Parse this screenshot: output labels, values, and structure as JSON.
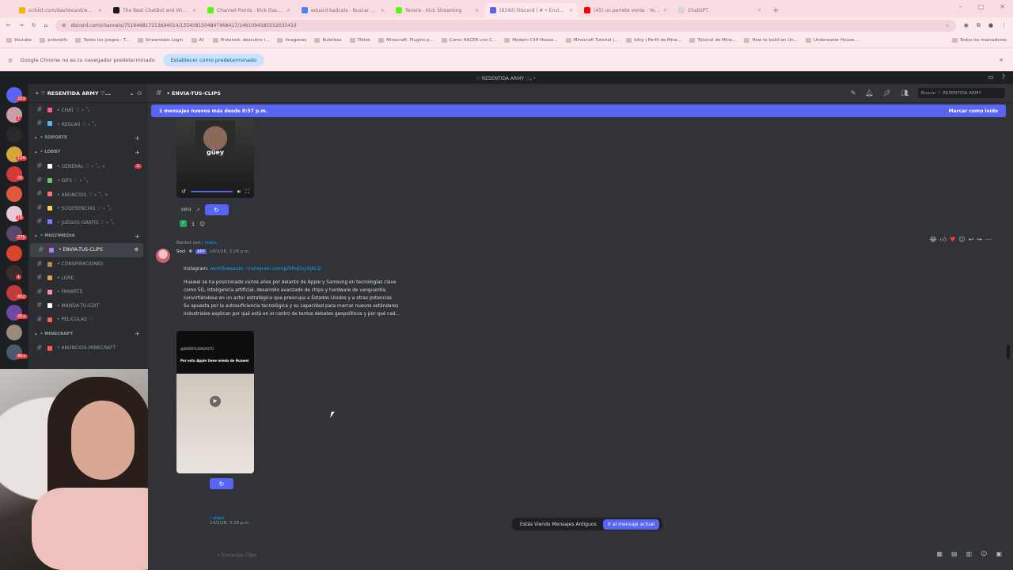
{
  "browser": {
    "tabs": [
      {
        "label": "scikkit.com/dashboard/w...",
        "color": "#f5b400"
      },
      {
        "label": "The Best ChatBot and Widget...",
        "color": "#1a1a1a"
      },
      {
        "label": "Channel Points - Kick Dashb...",
        "color": "#53fc18"
      },
      {
        "label": "eduard badcats - Buscar con G...",
        "color": "#4285f4"
      },
      {
        "label": "Tenera - Kick Streaming",
        "color": "#53fc18"
      },
      {
        "label": "(8340) Discord | # • Envía...",
        "color": "#5865f2"
      },
      {
        "label": "(45) un perrete verde - YouTube",
        "color": "#ff0000"
      },
      {
        "label": "ChatGPT",
        "color": "#d5d5d5"
      }
    ],
    "url": "discord.com/channels/751946817213694014/1354581504847468417/1461094585552035410",
    "bookmarks": [
      "Youtube",
      "anienstfv",
      "Todos los juegos - T...",
      "Streamlabs Login",
      "AI:",
      "Pinterest: descubre i...",
      "Imagenes",
      "Ruletitas",
      "Tiktok",
      "Minecraft: Plugins p...",
      "Como HACER uno C...",
      "Modern Cliff House...",
      "Minecraft Tutorial |...",
      "kitty | Perfil de Mine...",
      "Tutorial de Mine...",
      "How to build an Un...",
      "Underwater House...",
      "Todos los marcadores"
    ],
    "info_text": "Google Chrome no es tu navegador predeterminado",
    "info_button": "Establecer como predeterminado"
  },
  "discord": {
    "window_title": "♡ RESENTIDA ARMY ♡。・",
    "server_name": "✧ ♡ RESENTIDA ARMY ♡...",
    "server_badges": [
      "203",
      "1",
      "124",
      "30",
      "16",
      "275",
      "1",
      "402",
      "2K+",
      "4K+"
    ],
    "channels": [
      {
        "kind": "ch",
        "label": "• CHAT ♡ ⋆ ˚｡",
        "color": "#ff5c8a"
      },
      {
        "kind": "ch",
        "label": "• REGLAS ♡ ⋆ ˚｡",
        "color": "#5ab3ff"
      },
      {
        "kind": "cat",
        "label": "• SOPORTE"
      },
      {
        "kind": "cat",
        "label": "• LOBBY"
      },
      {
        "kind": "ch",
        "label": "• GENERAL ♡ ⋆ ˚｡ ✧",
        "color": "#ffffff",
        "unread": "1"
      },
      {
        "kind": "ch",
        "label": "• GIFS ♡ ⋆ ˚｡",
        "color": "#6ac46a"
      },
      {
        "kind": "ch",
        "label": "• ANUNCIOS ♡ ⋆ ˚｡ ✧",
        "color": "#ff7070"
      },
      {
        "kind": "ch",
        "label": "• SUGERENCIAS ♡ ⋆ ˚｡",
        "color": "#ffd34d"
      },
      {
        "kind": "ch",
        "label": "• JUEGOS-GRATIS ♡ ⋆ ˚｡",
        "color": "#7a7aff"
      },
      {
        "kind": "cat",
        "label": "• MULTIMEDIA"
      },
      {
        "kind": "ch",
        "label": "• ENVIA-TUS-CLIPS",
        "color": "#b57aff",
        "active": true
      },
      {
        "kind": "ch",
        "label": "• CONSPIRACIONES",
        "color": "#b58a5a"
      },
      {
        "kind": "ch",
        "label": "• LORE",
        "color": "#e0a64e"
      },
      {
        "kind": "ch",
        "label": "• FANARTS",
        "color": "#ff8fb1"
      },
      {
        "kind": "ch",
        "label": "• MANDA-TU-EDIT",
        "color": "#ffffff"
      },
      {
        "kind": "ch",
        "label": "• PELICULAS ♡",
        "color": "#ff5c5c"
      },
      {
        "kind": "cat",
        "label": "• MINECRAFT"
      },
      {
        "kind": "ch",
        "label": "• ANUNCIOS-MINECRAFT",
        "color": "#ff5c5c"
      }
    ],
    "channel_title": "• ENVIA-TUS-CLIPS",
    "search_placeholder": "Buscar ♡ RESENTIDA ARMY",
    "new_messages": "1 mensajes nuevos más desde 8:57 p.m.",
    "mark_read": "Marcar como leído",
    "clip1": {
      "overlay": "güey",
      "label": "MP4",
      "react_count": "1"
    },
    "message": {
      "reply_user": "Becket",
      "reply_verb": "usó",
      "reply_cmd": "/ video",
      "author": "Soci",
      "app_tag": "APP",
      "timestamp": "14/1/26, 3:28 p.m.",
      "source_prefix": "Instagram:",
      "source_user": "workflowsauto",
      "source_link": "instagram.com/p/DRqOxyXjAL3/",
      "body_line1": "Huawei se ha posicionado varios años por delante de Apple y Samsung en tecnologías clave",
      "body_line2": "como 5G, inteligencia artificial, desarrollo avanzado de chips y hardware de vanguardia,",
      "body_line3": "convirtiéndose en un actor estratégico que preocupa a Estados Unidos y a otras potencias",
      "body_line4": "Su apuesta por la autosuficiencia tecnológica y su capacidad para marcar nuevos estándares",
      "body_line5": "industriales explican por qué está en el centro de tantos debates geopolíticos y por qué cad...",
      "thumb_caption_top": "@WORKFLOWSAUTO",
      "thumb_caption": "Por esto Apple tiene miedo de Huawei"
    },
    "message2": {
      "cmd": "/ video",
      "timestamp": "14/1/26, 3:28 p.m."
    },
    "old_messages": "Estás Viendo Mensajes Antiguos",
    "jump_button": "Ir al mensaje actual",
    "input_placeholder": "• Envía-tus-Clips"
  }
}
